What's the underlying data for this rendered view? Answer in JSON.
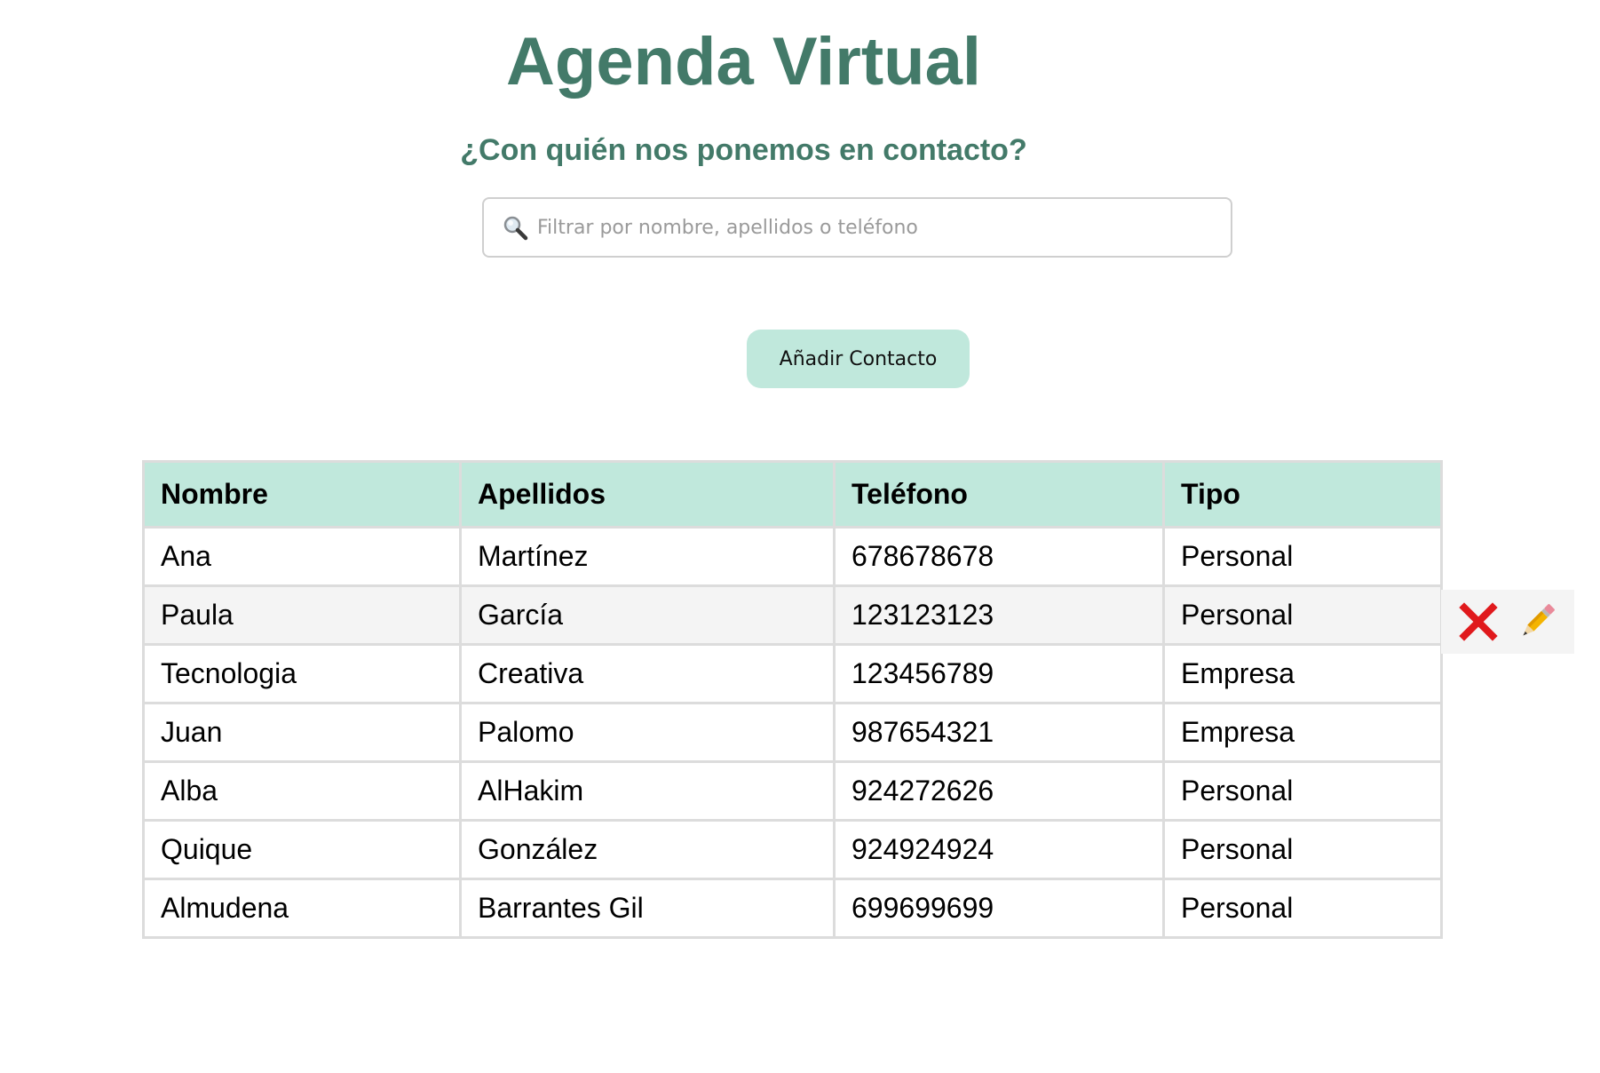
{
  "header": {
    "title": "Agenda Virtual",
    "subtitle": "¿Con quién nos ponemos en contacto?"
  },
  "search": {
    "placeholder": "Filtrar por nombre, apellidos o teléfono",
    "value": ""
  },
  "actions": {
    "add_label": "Añadir Contacto"
  },
  "table": {
    "columns": [
      "Nombre",
      "Apellidos",
      "Teléfono",
      "Tipo"
    ],
    "rows": [
      {
        "nombre": "Ana",
        "apellidos": "Martínez",
        "telefono": "678678678",
        "tipo": "Personal"
      },
      {
        "nombre": "Paula",
        "apellidos": "García",
        "telefono": "123123123",
        "tipo": "Personal"
      },
      {
        "nombre": "Tecnologia",
        "apellidos": "Creativa",
        "telefono": "123456789",
        "tipo": "Empresa"
      },
      {
        "nombre": "Juan",
        "apellidos": "Palomo",
        "telefono": "987654321",
        "tipo": "Empresa"
      },
      {
        "nombre": "Alba",
        "apellidos": "AlHakim",
        "telefono": "924272626",
        "tipo": "Personal"
      },
      {
        "nombre": "Quique",
        "apellidos": "González",
        "telefono": "924924924",
        "tipo": "Personal"
      },
      {
        "nombre": "Almudena",
        "apellidos": "Barrantes Gil",
        "telefono": "699699699",
        "tipo": "Personal"
      }
    ],
    "hovered_row": 1
  },
  "row_actions": {
    "delete_icon": "cross-mark-icon",
    "edit_icon": "pencil-icon"
  },
  "colors": {
    "accent": "#437a69",
    "header_bg": "#c0e8dc",
    "button_bg": "#c0e8dc",
    "hover_row_bg": "#f4f4f4",
    "delete_red": "#e0191c"
  }
}
